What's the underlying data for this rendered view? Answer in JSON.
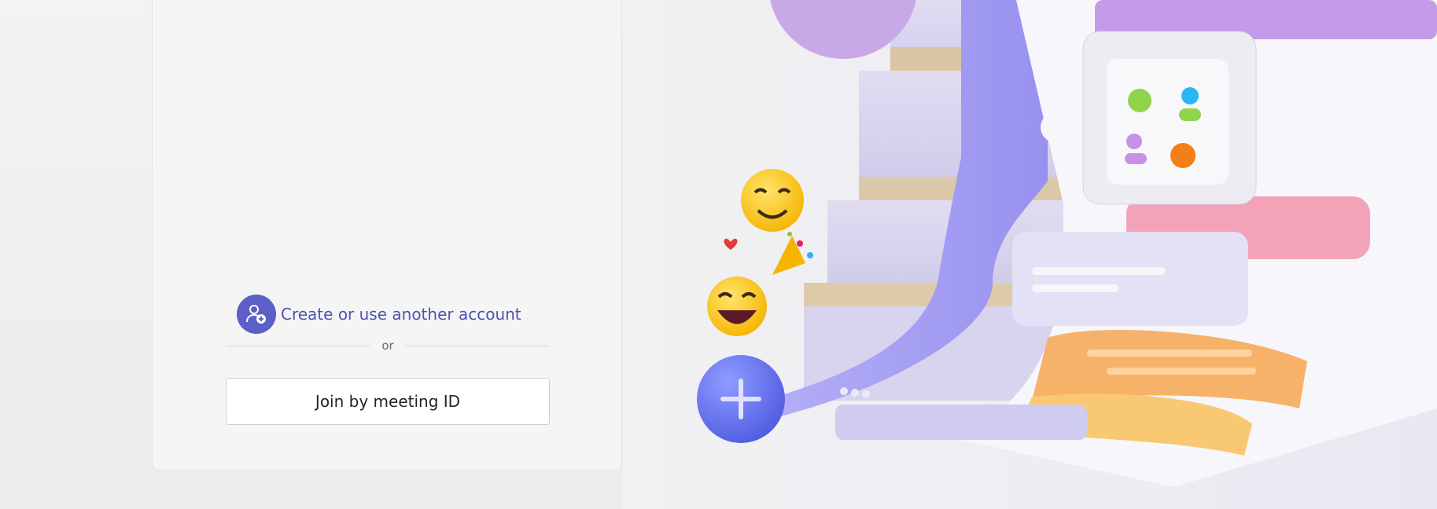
{
  "login": {
    "create_account_label": "Create or use another account",
    "divider_text": "or",
    "join_meeting_label": "Join by meeting ID"
  },
  "icons": {
    "account": "person-add-icon"
  },
  "colors": {
    "accent": "#5b5fc7",
    "link": "#4f52b2",
    "panel": "#f5f5f5",
    "button_border": "#cfcfcf"
  }
}
